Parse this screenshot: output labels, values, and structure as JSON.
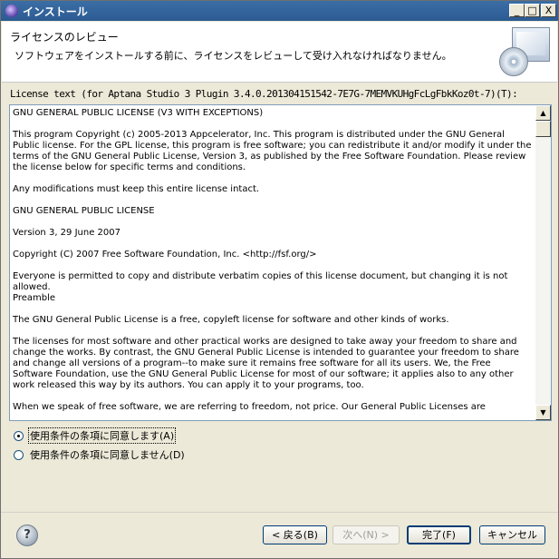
{
  "window": {
    "title": "インストール"
  },
  "titlebar": {
    "minimize": "_",
    "maximize": "□",
    "close": "X"
  },
  "header": {
    "title": "ライセンスのレビュー",
    "subtitle": "ソフトウェアをインストールする前に、ライセンスをレビューして受け入れなければなりません。"
  },
  "license": {
    "label": "License text (for Aptana Studio 3 Plugin 3.4.0.201304151542-7E7G-7MEMVKUHgFcLgFbkKoz0t-7)(T):",
    "text": "GNU GENERAL PUBLIC LICENSE (V3 WITH EXCEPTIONS)\n\nThis program Copyright (c) 2005-2013 Appcelerator, Inc. This program is distributed under the GNU General Public license. For the GPL license, this program is free software; you can redistribute it and/or modify it under the terms of the GNU General Public License, Version 3, as published by the Free Software Foundation. Please review the license below for specific terms and conditions.\n\nAny modifications must keep this entire license intact.\n\nGNU GENERAL PUBLIC LICENSE\n\nVersion 3, 29 June 2007\n\nCopyright (C) 2007 Free Software Foundation, Inc. <http://fsf.org/>\n\nEveryone is permitted to copy and distribute verbatim copies of this license document, but changing it is not allowed.\nPreamble\n\nThe GNU General Public License is a free, copyleft license for software and other kinds of works.\n\nThe licenses for most software and other practical works are designed to take away your freedom to share and change the works. By contrast, the GNU General Public License is intended to guarantee your freedom to share and change all versions of a program--to make sure it remains free software for all its users. We, the Free Software Foundation, use the GNU General Public License for most of our software; it applies also to any other work released this way by its authors. You can apply it to your programs, too.\n\nWhen we speak of free software, we are referring to freedom, not price. Our General Public Licenses are"
  },
  "options": {
    "accept": "使用条件の条項に同意します(A)",
    "decline": "使用条件の条項に同意しません(D)",
    "selected": "accept"
  },
  "buttons": {
    "help": "?",
    "back": "< 戻る(B)",
    "next": "次へ(N) >",
    "finish": "完了(F)",
    "cancel": "キャンセル"
  },
  "scrollbar": {
    "up": "▲",
    "down": "▼"
  }
}
